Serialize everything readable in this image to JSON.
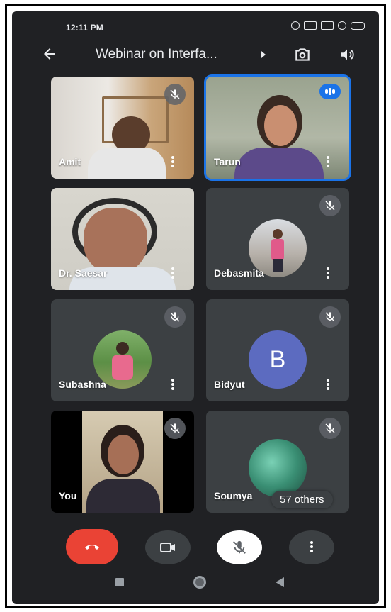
{
  "statusbar": {
    "time": "12:11 PM"
  },
  "topbar": {
    "title": "Webinar on Interfa..."
  },
  "participants": [
    {
      "name": "Amit"
    },
    {
      "name": "Tarun"
    },
    {
      "name": "Dr. Saesar"
    },
    {
      "name": "Debasmita"
    },
    {
      "name": "Subashna"
    },
    {
      "name": "Bidyut",
      "initial": "B"
    },
    {
      "name": "You"
    },
    {
      "name": "Soumya"
    }
  ],
  "others": {
    "label": "57 others"
  },
  "colors": {
    "background": "#202124",
    "tile": "#3c4043",
    "end_call": "#ea4335",
    "speaking": "#1a73e8",
    "avatar": "#5c6bc0"
  },
  "icons": [
    "back-arrow-icon",
    "switch-camera-icon",
    "speaker-icon",
    "mic-off-icon",
    "end-call-icon",
    "camera-icon",
    "more-vert-icon"
  ]
}
